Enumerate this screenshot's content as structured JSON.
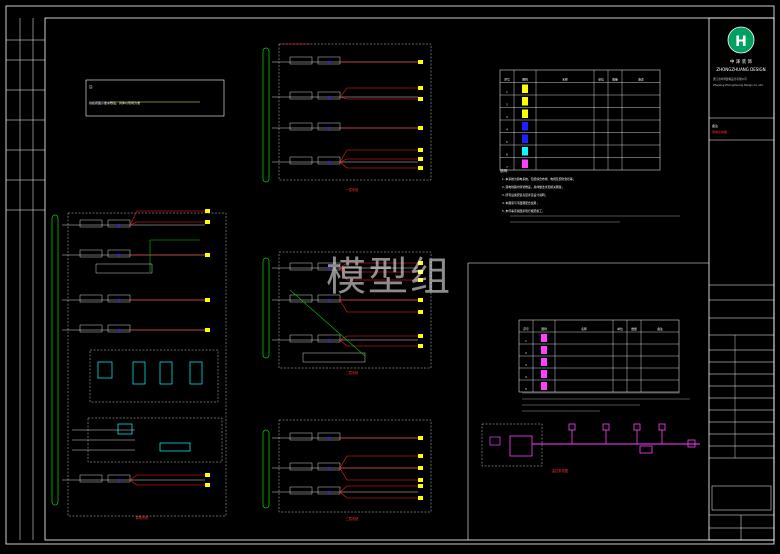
{
  "watermark": "模型组",
  "title_block": {
    "logo_letter": "H",
    "company_cn": "中 泽 装 饰",
    "company_en": "ZHONGZHUANG  DESIGN",
    "small_lines": [
      "浙江省中泽建筑设计有限公司",
      "Zhejiang Zhongzhuang Design Co.,Ltd."
    ],
    "red_note": "弱电系统图"
  },
  "notes": {
    "label": "备注",
    "line1": "注：",
    "line2": "线缆按图示要求敷设，具体以现场为准"
  },
  "legend_top": {
    "headers": [
      "序号",
      "图例",
      "名称",
      "单位",
      "数量",
      "备注"
    ],
    "rows": [
      "1",
      "2",
      "3",
      "4",
      "5",
      "6",
      "7"
    ]
  },
  "legend_bottom": {
    "headers": [
      "序号",
      "图例",
      "名称",
      "单位",
      "数量",
      "备注"
    ],
    "rows": [
      "1",
      "2",
      "3",
      "4",
      "5"
    ]
  },
  "explanation": {
    "title": "说明：",
    "lines": [
      "1. 本系统为弱电系统，包括综合布线、电视及安防监控等；",
      "2. 弱电线路均穿管敷设，具体做法详见相关图集；",
      "3. 所有设备安装高度详见设计说明；",
      "4. 本图需与平面图配合使用；",
      "5. 未尽事宜按国家现行规范施工。"
    ]
  },
  "captions": {
    "left_system": "弱电系统",
    "mid_top": "一层系统",
    "mid_mid": "二层系统",
    "mid_bot": "三层系统",
    "right_system": "监控系统图"
  },
  "colors": {
    "green": "#00c800",
    "red": "#ff2020",
    "yellow": "#ffff00",
    "blue": "#2020ff",
    "magenta": "#ff40ff",
    "cyan": "#00ffff",
    "white": "#ffffff",
    "line_gray": "#d8d8d8"
  }
}
